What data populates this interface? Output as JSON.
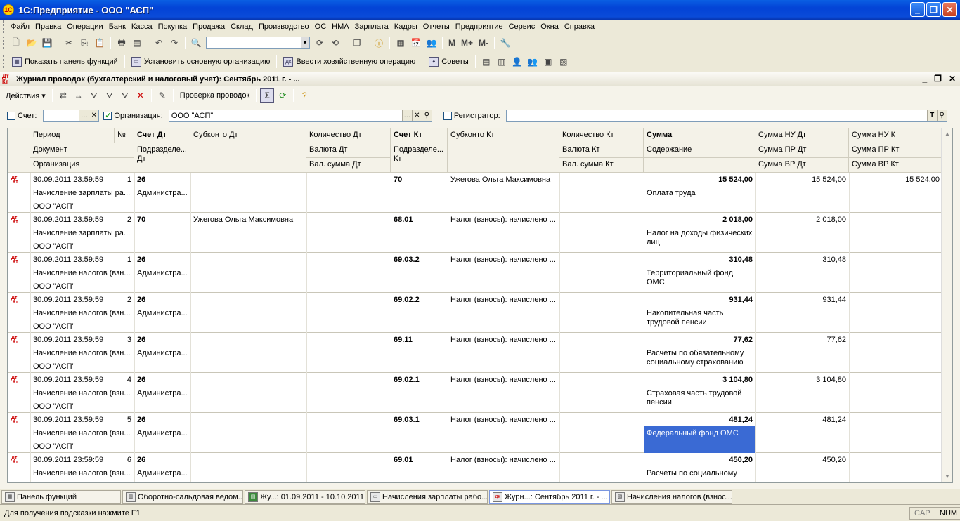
{
  "window": {
    "title": "1С:Предприятие - ООО \"АСП\"",
    "app_icon": "1С"
  },
  "menu": [
    "Файл",
    "Правка",
    "Операции",
    "Банк",
    "Касса",
    "Покупка",
    "Продажа",
    "Склад",
    "Производство",
    "ОС",
    "НМА",
    "Зарплата",
    "Кадры",
    "Отчеты",
    "Предприятие",
    "Сервис",
    "Окна",
    "Справка"
  ],
  "toolbar2": {
    "show_panel": "Показать панель функций",
    "set_org": "Установить основную организацию",
    "enter_op": "Ввести хозяйственную операцию",
    "tips": "Советы"
  },
  "toolbar1": {
    "m": "M",
    "mplus": "M+",
    "mminus": "M-"
  },
  "doc": {
    "title": "Журнал проводок (бухгалтерский и налоговый учет): Сентябрь 2011 г. - ..."
  },
  "actions": {
    "label": "Действия",
    "check": "Проверка проводок"
  },
  "filters": {
    "account_label": "Счет:",
    "org_label": "Организация:",
    "org_value": "ООО \"АСП\"",
    "registrar_label": "Регистратор:"
  },
  "columns": {
    "period": "Период",
    "num": "№",
    "dt": "Счет Дт",
    "sub_dt": "Субконто Дт",
    "qty_dt": "Количество Дт",
    "kt": "Счет Кт",
    "sub_kt": "Субконто Кт",
    "qty_kt": "Количество Кт",
    "sum": "Сумма",
    "nu_dt": "Сумма НУ Дт",
    "nu_kt": "Сумма НУ Кт",
    "document": "Документ",
    "div_dt": "Подразделе... Дт",
    "cur_dt": "Валюта Дт",
    "div_kt": "Подразделе... Кт",
    "cur_kt": "Валюта Кт",
    "content": "Содержание",
    "pr_dt": "Сумма ПР Дт",
    "pr_kt": "Сумма ПР Кт",
    "organization": "Организация",
    "valsum_dt": "Вал. сумма Дт",
    "valsum_kt": "Вал. сумма Кт",
    "vr_dt": "Сумма ВР Дт",
    "vr_kt": "Сумма ВР Кт"
  },
  "rows": [
    {
      "period": "30.09.2011 23:59:59",
      "num": "1",
      "dt": "26",
      "sub_dt": "",
      "kt": "70",
      "sub_kt": "Ужегова Ольга Максимовна",
      "sum": "15 524,00",
      "nu_dt": "15 524,00",
      "nu_kt": "15 524,00",
      "doc": "Начисление зарплаты ра...",
      "div_dt": "Администра...",
      "content": "Оплата труда",
      "org": "ООО \"АСП\""
    },
    {
      "period": "30.09.2011 23:59:59",
      "num": "2",
      "dt": "70",
      "sub_dt": "Ужегова Ольга Максимовна",
      "kt": "68.01",
      "sub_kt": "Налог (взносы): начислено ...",
      "sum": "2 018,00",
      "nu_dt": "2 018,00",
      "nu_kt": "",
      "doc": "Начисление зарплаты ра...",
      "div_dt": "",
      "content": "Налог на доходы физических лиц",
      "org": "ООО \"АСП\""
    },
    {
      "period": "30.09.2011 23:59:59",
      "num": "1",
      "dt": "26",
      "sub_dt": "",
      "kt": "69.03.2",
      "sub_kt": "Налог (взносы): начислено ...",
      "sum": "310,48",
      "nu_dt": "310,48",
      "nu_kt": "",
      "doc": "Начисление налогов (взн...",
      "div_dt": "Администра...",
      "content": "Территориальный фонд ОМС",
      "org": "ООО \"АСП\""
    },
    {
      "period": "30.09.2011 23:59:59",
      "num": "2",
      "dt": "26",
      "sub_dt": "",
      "kt": "69.02.2",
      "sub_kt": "Налог (взносы): начислено ...",
      "sum": "931,44",
      "nu_dt": "931,44",
      "nu_kt": "",
      "doc": "Начисление налогов (взн...",
      "div_dt": "Администра...",
      "content": "Накопительная часть трудовой пенсии",
      "org": "ООО \"АСП\""
    },
    {
      "period": "30.09.2011 23:59:59",
      "num": "3",
      "dt": "26",
      "sub_dt": "",
      "kt": "69.11",
      "sub_kt": "Налог (взносы): начислено ...",
      "sum": "77,62",
      "nu_dt": "77,62",
      "nu_kt": "",
      "doc": "Начисление налогов (взн...",
      "div_dt": "Администра...",
      "content": "Расчеты по обязательному социальному страхованию",
      "org": "ООО \"АСП\""
    },
    {
      "period": "30.09.2011 23:59:59",
      "num": "4",
      "dt": "26",
      "sub_dt": "",
      "kt": "69.02.1",
      "sub_kt": "Налог (взносы): начислено ...",
      "sum": "3 104,80",
      "nu_dt": "3 104,80",
      "nu_kt": "",
      "doc": "Начисление налогов (взн...",
      "div_dt": "Администра...",
      "content": "Страховая часть трудовой пенсии",
      "org": "ООО \"АСП\""
    },
    {
      "period": "30.09.2011 23:59:59",
      "num": "5",
      "dt": "26",
      "sub_dt": "",
      "kt": "69.03.1",
      "sub_kt": "Налог (взносы): начислено ...",
      "sum": "481,24",
      "nu_dt": "481,24",
      "nu_kt": "",
      "doc": "Начисление налогов (взн...",
      "div_dt": "Администра...",
      "content": "Федеральный фонд ОМС",
      "org": "ООО \"АСП\""
    },
    {
      "period": "30.09.2011 23:59:59",
      "num": "6",
      "dt": "26",
      "sub_dt": "",
      "kt": "69.01",
      "sub_kt": "Налог (взносы): начислено ...",
      "sum": "450,20",
      "nu_dt": "450,20",
      "nu_kt": "",
      "doc": "Начисление налогов (взн...",
      "div_dt": "Администра...",
      "content": "Расчеты по социальному",
      "org": ""
    }
  ],
  "taskbar": [
    "Панель функций",
    "Оборотно-сальдовая ведом...",
    "Жу...: 01.09.2011 - 10.10.2011",
    "Начисления зарплаты рабо...",
    "Журн...: Сентябрь 2011 г. - ...",
    "Начисления налогов (взнос..."
  ],
  "status": {
    "hint": "Для получения подсказки нажмите F1",
    "cap": "CAP",
    "num": "NUM"
  }
}
